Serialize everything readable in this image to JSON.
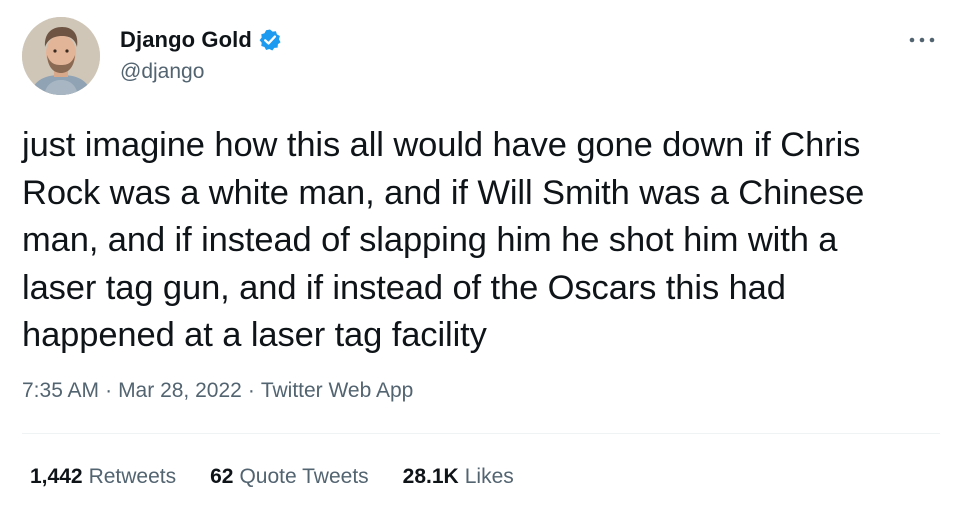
{
  "author": {
    "display_name": "Django Gold",
    "handle": "@django",
    "verified": true
  },
  "tweet": {
    "text": "just imagine how this all would have gone down if Chris\nRock was a white man, and if Will Smith was a Chinese\nman, and if instead of slapping him he shot him with a\nlaser tag gun, and if instead of the Oscars this had\nhappened at a laser tag facility",
    "time": "7:35 AM",
    "date": "Mar 28, 2022",
    "source": "Twitter Web App",
    "separator": "·"
  },
  "stats": {
    "retweets_count": "1,442",
    "retweets_label": "Retweets",
    "quotes_count": "62",
    "quotes_label": "Quote Tweets",
    "likes_count": "28.1K",
    "likes_label": "Likes"
  },
  "icons": {
    "verified": "verified-badge-icon",
    "more": "more-options-icon"
  },
  "colors": {
    "text": "#0f1419",
    "secondary": "#536471",
    "verified_blue": "#1d9bf0",
    "divider": "#eff3f4"
  }
}
